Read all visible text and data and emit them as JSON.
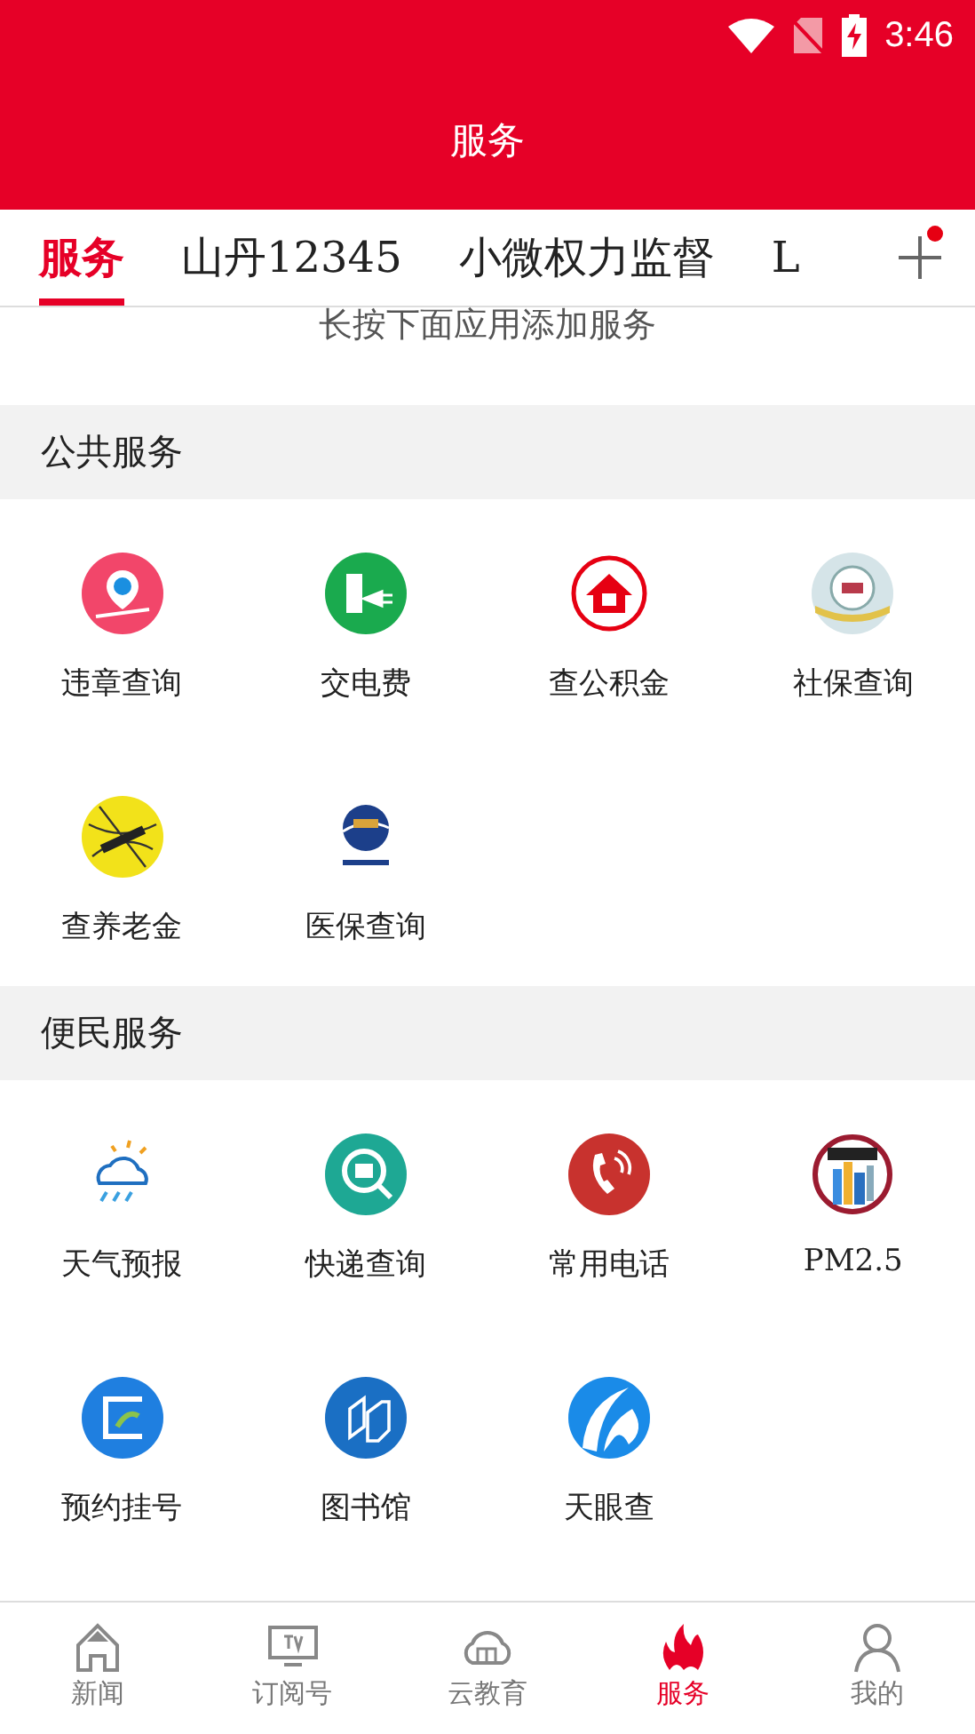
{
  "status_bar": {
    "time": "3:46"
  },
  "header": {
    "title": "服务"
  },
  "tabs": [
    {
      "label": "服务",
      "selected": true
    },
    {
      "label": "山丹12345",
      "selected": false
    },
    {
      "label": "小微权力监督",
      "selected": false
    },
    {
      "label": "L",
      "selected": false
    }
  ],
  "add_button": {
    "badge": true
  },
  "hint": "长按下面应用添加服务",
  "sections": [
    {
      "title": "公共服务",
      "items": [
        {
          "label": "违章查询",
          "kind": "violation"
        },
        {
          "label": "交电费",
          "kind": "power"
        },
        {
          "label": "查公积金",
          "kind": "house"
        },
        {
          "label": "社保查询",
          "kind": "social"
        },
        {
          "label": "查养老金",
          "kind": "pension"
        },
        {
          "label": "医保查询",
          "kind": "medical"
        }
      ]
    },
    {
      "title": "便民服务",
      "items": [
        {
          "label": "天气预报",
          "kind": "weather"
        },
        {
          "label": "快递查询",
          "kind": "express"
        },
        {
          "label": "常用电话",
          "kind": "phone"
        },
        {
          "label": "PM2.5",
          "kind": "pm"
        },
        {
          "label": "预约挂号",
          "kind": "hospital"
        },
        {
          "label": "图书馆",
          "kind": "library"
        },
        {
          "label": "天眼查",
          "kind": "eye"
        }
      ]
    }
  ],
  "bottom_nav": [
    {
      "label": "新闻",
      "kind": "home",
      "selected": false
    },
    {
      "label": "订阅号",
      "kind": "tv",
      "selected": false
    },
    {
      "label": "云教育",
      "kind": "cloud",
      "selected": false
    },
    {
      "label": "服务",
      "kind": "fire",
      "selected": true
    },
    {
      "label": "我的",
      "kind": "person",
      "selected": false
    }
  ]
}
